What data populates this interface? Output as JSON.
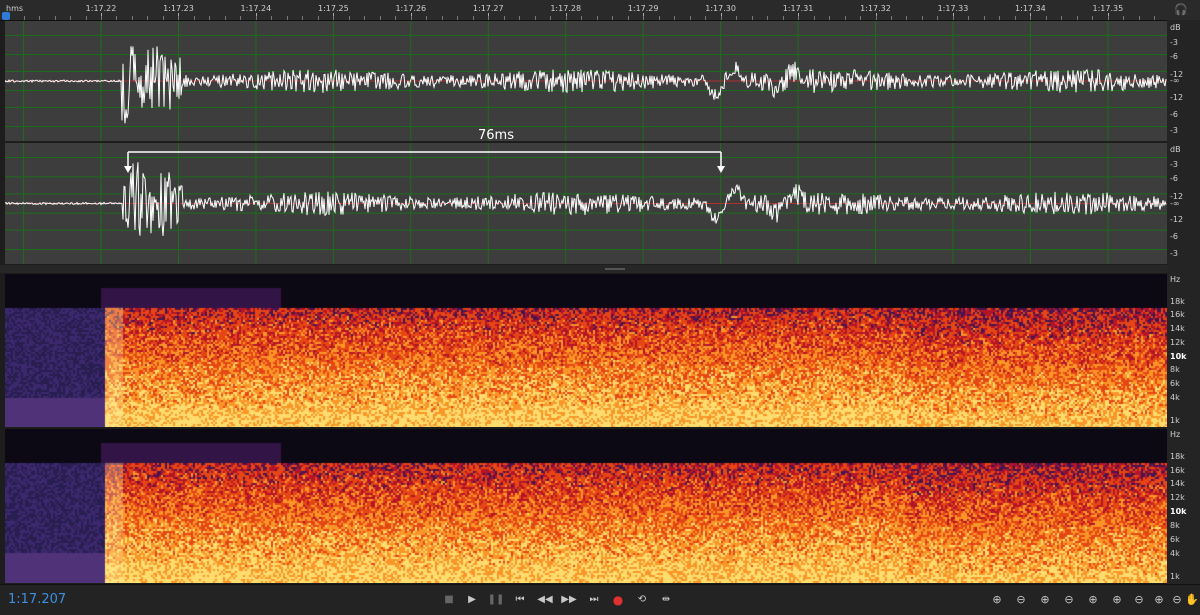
{
  "ruler": {
    "unit": "hms",
    "ticks": [
      "1:17.22",
      "1:17.23",
      "1:17.24",
      "1:17.25",
      "1:17.26",
      "1:17.27",
      "1:17.28",
      "1:17.29",
      "1:17.30",
      "1:17.31",
      "1:17.32",
      "1:17.33",
      "1:17.34",
      "1:17.35"
    ]
  },
  "amplitude_scale": {
    "channel_1": [
      "dB",
      "-3",
      "-6",
      "-12",
      "-∞",
      "-12",
      "-6",
      "-3"
    ],
    "channel_2": [
      "dB",
      "-3",
      "-6",
      "-12",
      "-∞",
      "-12",
      "-6",
      "-3"
    ]
  },
  "frequency_scale": {
    "channel_1": [
      "Hz",
      "18k",
      "16k",
      "14k",
      "12k",
      "10k",
      "8k",
      "6k",
      "4k",
      "1k"
    ],
    "channel_2": [
      "Hz",
      "18k",
      "16k",
      "14k",
      "12k",
      "10k",
      "8k",
      "6k",
      "4k",
      "1k"
    ]
  },
  "measurement": {
    "label": "76ms"
  },
  "transport": {
    "time": "1:17.207",
    "buttons": [
      {
        "name": "stop-button",
        "glyph": "■"
      },
      {
        "name": "play-button",
        "glyph": "▶"
      },
      {
        "name": "pause-button",
        "glyph": "❚❚"
      },
      {
        "name": "go-to-start-button",
        "glyph": "⏮"
      },
      {
        "name": "rewind-button",
        "glyph": "◀◀"
      },
      {
        "name": "fast-forward-button",
        "glyph": "▶▶"
      },
      {
        "name": "go-to-end-button",
        "glyph": "⏭"
      },
      {
        "name": "record-button",
        "glyph": "●"
      },
      {
        "name": "loop-button",
        "glyph": "⟲"
      },
      {
        "name": "skip-selection-button",
        "glyph": "⇹"
      }
    ],
    "zoom_buttons": [
      {
        "name": "zoom-in-amplitude-button",
        "glyph": "⊕"
      },
      {
        "name": "zoom-out-amplitude-button",
        "glyph": "⊖"
      },
      {
        "name": "zoom-in-time-button",
        "glyph": "⊕"
      },
      {
        "name": "zoom-out-time-button",
        "glyph": "⊖"
      },
      {
        "name": "zoom-in-left-button",
        "glyph": "⊕"
      },
      {
        "name": "zoom-in-right-button",
        "glyph": "⊕"
      },
      {
        "name": "zoom-out-full-button",
        "glyph": "⊖"
      },
      {
        "name": "zoom-to-selection-button",
        "glyph": "⊕"
      },
      {
        "name": "zoom-reset-button",
        "glyph": "⊖"
      },
      {
        "name": "hand-tool-button",
        "glyph": "✋"
      }
    ]
  },
  "colors": {
    "playhead": "#2e7bd6",
    "waveform": "#ffffff",
    "panel": "#3d3d3d",
    "grid": "#1c6e1c",
    "zero_line": "#b03030",
    "time_display": "#3b8fe0",
    "record": "#e03030"
  }
}
